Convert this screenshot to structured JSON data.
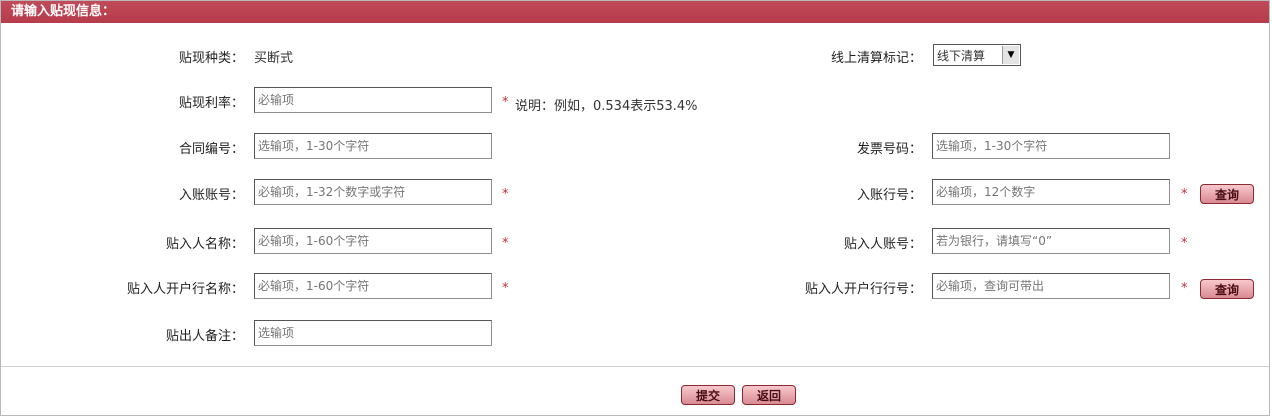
{
  "header": {
    "title": "请输入贴现信息："
  },
  "rows": {
    "discount_type": {
      "label": "贴现种类：",
      "value": "买断式"
    },
    "settlement_flag": {
      "label": "线上清算标记：",
      "selected": "线下清算"
    },
    "discount_rate": {
      "label": "贴现利率：",
      "placeholder": "必输项",
      "note": "说明：例如，0.534表示53.4%"
    },
    "contract_no": {
      "label": "合同编号：",
      "placeholder": "选输项，1-30个字符"
    },
    "invoice_no": {
      "label": "发票号码：",
      "placeholder": "选输项，1-30个字符"
    },
    "inbound_account": {
      "label": "入账账号：",
      "placeholder": "必输项，1-32个数字或字符"
    },
    "inbound_bank": {
      "label": "入账行号：",
      "placeholder": "必输项，12个数字",
      "query_label": "查询"
    },
    "recipient_name": {
      "label": "贴入人名称：",
      "placeholder": "必输项，1-60个字符"
    },
    "recipient_account": {
      "label": "贴入人账号：",
      "placeholder": "若为银行，请填写“0”"
    },
    "recipient_bank_name": {
      "label": "贴入人开户行名称：",
      "placeholder": "必输项，1-60个字符"
    },
    "recipient_bank_no": {
      "label": "贴入人开户行行号：",
      "placeholder": "必输项，查询可带出",
      "query_label": "查询"
    },
    "payer_remark": {
      "label": "贴出人备注：",
      "placeholder": "选输项"
    }
  },
  "required_mark": "*",
  "footer": {
    "submit_label": "提交",
    "back_label": "返回"
  }
}
